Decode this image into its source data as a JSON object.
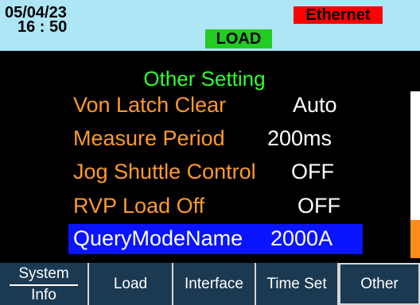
{
  "status": {
    "date": "05/04/23",
    "time": "16 : 50",
    "interface_badge": "Ethernet",
    "mode_badge": "LOAD",
    "colors": {
      "bar_bg": "#aee6f6",
      "ethernet": "#ff0000",
      "load": "#22cc22"
    }
  },
  "screen": {
    "title": "Other Setting",
    "items": [
      {
        "label": "Von Latch Clear",
        "value": "Auto"
      },
      {
        "label": "Measure Period",
        "value": "200ms"
      },
      {
        "label": "Jog Shuttle Control",
        "value": "OFF"
      },
      {
        "label": "RVP Load Off",
        "value": "OFF"
      },
      {
        "label": "QueryModeName",
        "value": "2000A",
        "selected": true
      }
    ],
    "scroll_position": 0.77
  },
  "softkeys": [
    {
      "line1": "System",
      "line2": "Info"
    },
    {
      "label": "Load"
    },
    {
      "label": "Interface"
    },
    {
      "label": "Time Set"
    },
    {
      "label": "Other",
      "active": true
    }
  ]
}
